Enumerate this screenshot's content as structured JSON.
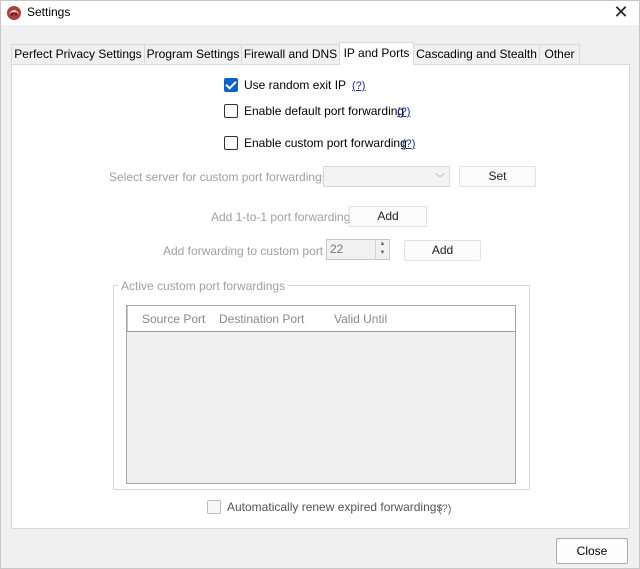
{
  "window": {
    "title": "Settings"
  },
  "tabs": [
    {
      "label": "Perfect Privacy Settings"
    },
    {
      "label": "Program Settings"
    },
    {
      "label": "Firewall and DNS"
    },
    {
      "label": "IP and Ports",
      "active": true
    },
    {
      "label": "Cascading and Stealth"
    },
    {
      "label": "Other"
    }
  ],
  "options": {
    "random_exit_ip": {
      "label": "Use random exit IP",
      "checked": true,
      "help": "(?)"
    },
    "default_port_fwd": {
      "label": "Enable default port forwarding",
      "checked": false,
      "help": "(?)"
    },
    "custom_port_fwd": {
      "label": "Enable custom port forwarding",
      "checked": false,
      "help": "(?)"
    }
  },
  "server_select": {
    "label": "Select server for custom port forwardings",
    "value": "",
    "set_label": "Set"
  },
  "one_to_one": {
    "label": "Add 1-to-1 port forwarding",
    "add_label": "Add"
  },
  "custom_port": {
    "label": "Add forwarding to custom port",
    "value": "22",
    "add_label": "Add"
  },
  "active_forwardings": {
    "title": "Active custom port forwardings",
    "columns": [
      "Source Port",
      "Destination Port",
      "Valid Until"
    ],
    "rows": []
  },
  "auto_renew": {
    "label": "Automatically renew expired forwardings",
    "checked": false,
    "help": "(?)"
  },
  "footer": {
    "close_label": "Close"
  },
  "colors": {
    "accent": "#0a64c8",
    "help_link": "#1a2fa0",
    "disabled_text": "#a0a0a0"
  }
}
